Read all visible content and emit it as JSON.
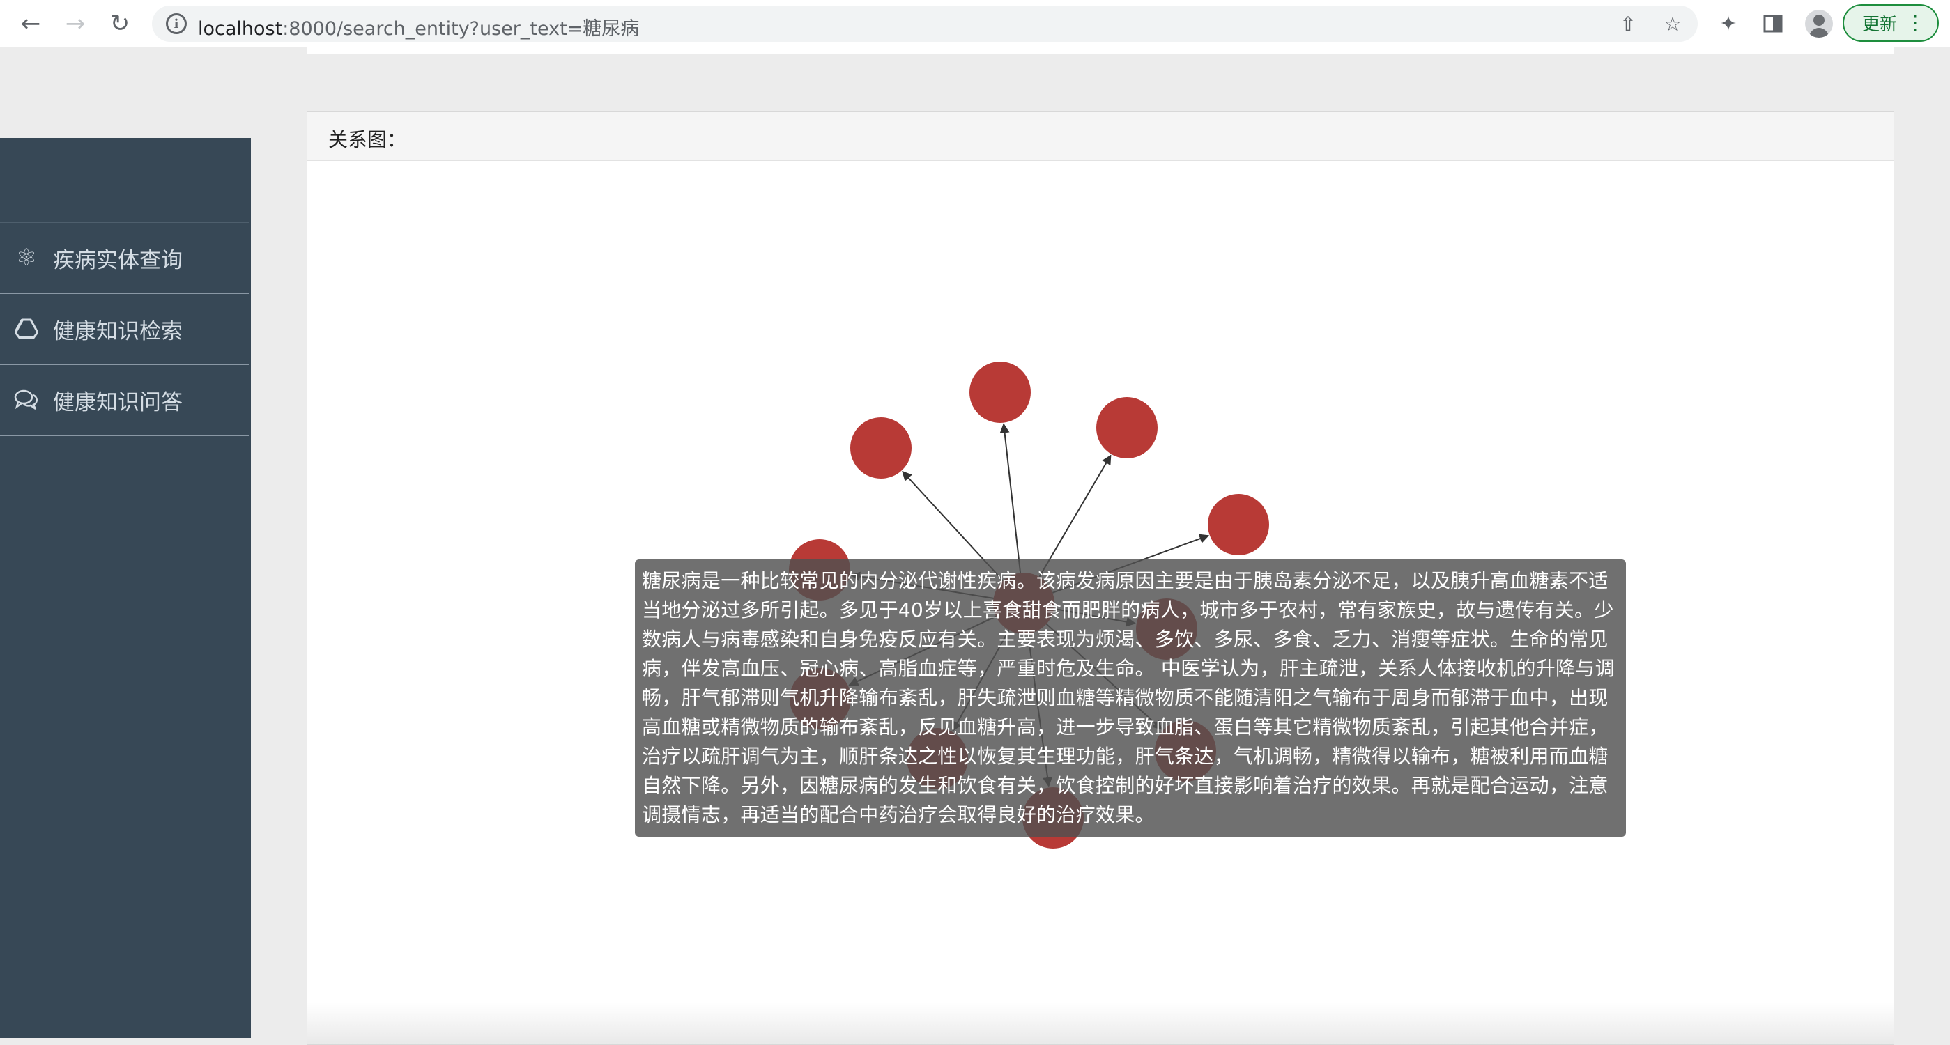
{
  "browser": {
    "url_host": "localhost",
    "url_rest": ":8000/search_entity?user_text=糖尿病",
    "update_label": "更新"
  },
  "sidebar": {
    "items": [
      {
        "label": "疾病实体查询",
        "icon": "atom-icon"
      },
      {
        "label": "健康知识检索",
        "icon": "drive-icon"
      },
      {
        "label": "健康知识问答",
        "icon": "chat-bubbles-icon"
      }
    ]
  },
  "panel": {
    "title": "关系图："
  },
  "graph": {
    "node_color": "#b83a36",
    "edge_color": "#333333"
  },
  "tooltip": {
    "text": "糖尿病是一种比较常见的内分泌代谢性疾病。该病发病原因主要是由于胰岛素分泌不足，以及胰升高血糖素不适当地分泌过多所引起。多见于40岁以上喜食甜食而肥胖的病人，城市多于农村，常有家族史，故与遗传有关。少数病人与病毒感染和自身免疫反应有关。主要表现为烦渴、多饮、多尿、多食、乏力、消瘦等症状。生命的常见病，伴发高血压、冠心病、高脂血症等，严重时危及生命。 中医学认为，肝主疏泄，关系人体接收机的升降与调畅，肝气郁滞则气机升降输布紊乱，肝失疏泄则血糖等精微物质不能随清阳之气输布于周身而郁滞于血中，出现高血糖或精微物质的输布紊乱，反见血糖升高，进一步导致血脂、蛋白等其它精微物质紊乱，引起其他合并症，治疗以疏肝调气为主，顺肝条达之性以恢复其生理功能，肝气条达，气机调畅，精微得以输布，糖被利用而血糖自然下降。另外，因糖尿病的发生和饮食有关，饮食控制的好坏直接影响着治疗的效果。再就是配合运动，注意调摄情志，再适当的配合中药治疗会取得良好的治疗效果。"
  }
}
